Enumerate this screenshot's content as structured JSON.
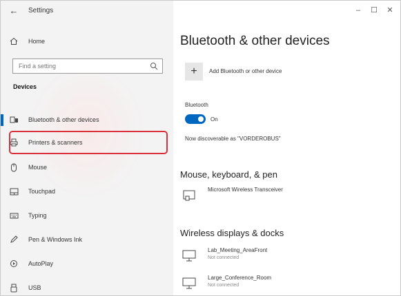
{
  "window": {
    "title": "Settings",
    "back_icon": "back-arrow-icon",
    "minimize": "–",
    "maximize": "☐",
    "close": "✕"
  },
  "sidebar": {
    "home_label": "Home",
    "search_placeholder": "Find a setting",
    "section": "Devices",
    "items": [
      {
        "label": "Bluetooth & other devices",
        "icon": "bluetooth-devices-icon"
      },
      {
        "label": "Printers & scanners",
        "icon": "printer-icon"
      },
      {
        "label": "Mouse",
        "icon": "mouse-icon"
      },
      {
        "label": "Touchpad",
        "icon": "touchpad-icon"
      },
      {
        "label": "Typing",
        "icon": "keyboard-icon"
      },
      {
        "label": "Pen & Windows Ink",
        "icon": "pen-icon"
      },
      {
        "label": "AutoPlay",
        "icon": "autoplay-icon"
      },
      {
        "label": "USB",
        "icon": "usb-icon"
      }
    ]
  },
  "main": {
    "title": "Bluetooth & other devices",
    "add_device_label": "Add Bluetooth or other device",
    "bluetooth_label": "Bluetooth",
    "toggle_state": "On",
    "discoverable_text": "Now discoverable as \"VORDEROBUS\"",
    "mouse_section": "Mouse, keyboard, & pen",
    "mouse_device": "Microsoft Wireless Transceiver",
    "wireless_section": "Wireless displays & docks",
    "displays": [
      {
        "name": "Lab_Meeting_AreaFront",
        "status": "Not connected"
      },
      {
        "name": "Large_Conference_Room",
        "status": "Not connected"
      }
    ]
  },
  "colors": {
    "accent": "#0067c0",
    "highlight_border": "#d9303c",
    "sidebar_bg": "#f3f3f3"
  }
}
